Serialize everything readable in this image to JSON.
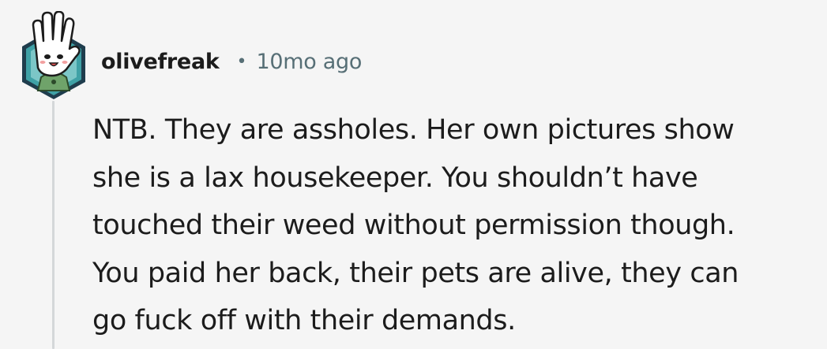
{
  "comment": {
    "author": "olivefreak",
    "separator": "•",
    "age": "10mo ago",
    "avatar_icon": "waving-hand-avatar-icon",
    "body_lines": [
      "NTB. They are assholes. Her own pictures show",
      "she is a lax housekeeper. You shouldn’t have",
      "touched their weed without permission though.",
      "You paid her back, their pets are alive, they can",
      "go fuck off with their demands."
    ]
  },
  "colors": {
    "background": "#f5f5f5",
    "text": "#1c1c1c",
    "meta": "#576f76",
    "thread_line": "#d4d7d9",
    "avatar_teal": "#3fa1a6",
    "avatar_dark": "#1f3d4d",
    "avatar_green": "#6fa36a"
  }
}
